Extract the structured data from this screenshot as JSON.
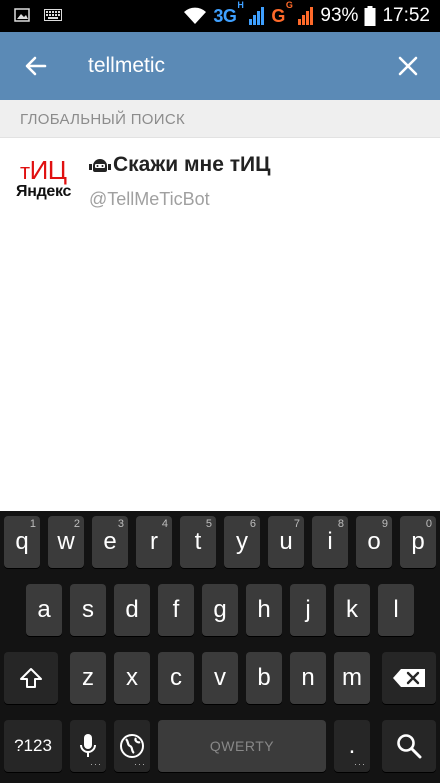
{
  "status_bar": {
    "net_3g": "3G",
    "net_3g_sup": "H",
    "net_g": "G",
    "net_g_sup": "G",
    "battery": "93%",
    "time": "17:52",
    "icons": [
      "image-notification-icon",
      "keyboard-notification-icon",
      "wifi-icon",
      "signal-icon",
      "battery-icon"
    ]
  },
  "action_bar": {
    "search_value": "tellmetic",
    "color": "#5b8ab6",
    "back_icon": "arrow-left-icon",
    "clear_icon": "close-icon"
  },
  "section": {
    "title": "ГЛОБАЛЬНЫЙ ПОИСК"
  },
  "result": {
    "avatar_line1_a": "т",
    "avatar_line1_b": "ИЦ",
    "avatar_line2": "Яндекс",
    "title": "Скажи мне тИЦ",
    "username": "@TellMeTicBot",
    "bot_icon": "bot-icon"
  },
  "keyboard": {
    "row1": [
      {
        "label": "q",
        "hint": "1"
      },
      {
        "label": "w",
        "hint": "2"
      },
      {
        "label": "e",
        "hint": "3"
      },
      {
        "label": "r",
        "hint": "4"
      },
      {
        "label": "t",
        "hint": "5"
      },
      {
        "label": "y",
        "hint": "6"
      },
      {
        "label": "u",
        "hint": "7"
      },
      {
        "label": "i",
        "hint": "8"
      },
      {
        "label": "o",
        "hint": "9"
      },
      {
        "label": "p",
        "hint": "0"
      }
    ],
    "row2": [
      "a",
      "s",
      "d",
      "f",
      "g",
      "h",
      "j",
      "k",
      "l"
    ],
    "row3": [
      "z",
      "x",
      "c",
      "v",
      "b",
      "n",
      "m"
    ],
    "symbols_label": "?123",
    "space_label": "QWERTY",
    "period_label": ".",
    "icons": [
      "shift-icon",
      "backspace-icon",
      "mic-icon",
      "globe-icon",
      "search-icon"
    ]
  }
}
